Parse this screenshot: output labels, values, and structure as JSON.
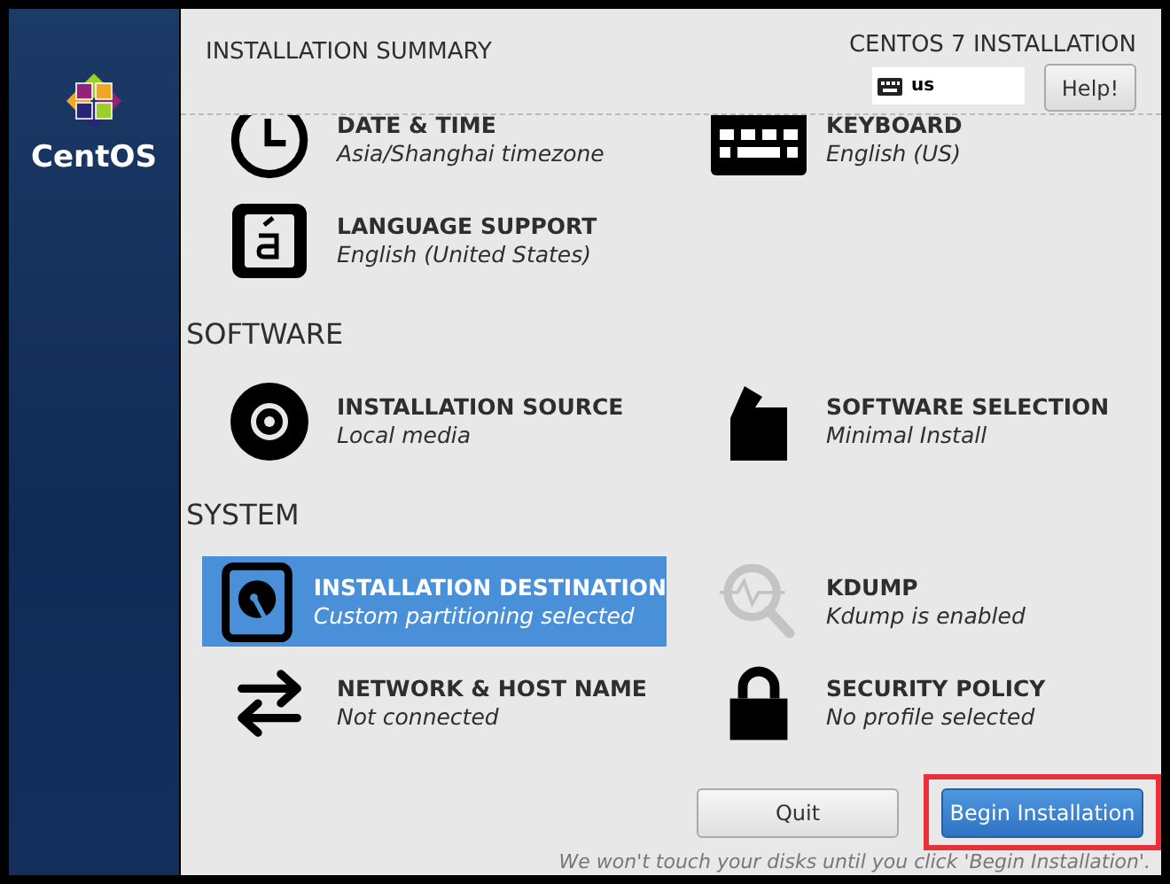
{
  "sidebar": {
    "logo_text": "CentOS"
  },
  "header": {
    "title": "INSTALLATION SUMMARY",
    "product": "CENTOS 7 INSTALLATION",
    "keyboard_layout": "us",
    "help_button": "Help!"
  },
  "sections": [
    {
      "items": [
        {
          "title": "DATE & TIME",
          "status": "Asia/Shanghai timezone",
          "selected": false
        },
        {
          "title": "KEYBOARD",
          "status": "English (US)",
          "selected": false
        },
        {
          "title": "LANGUAGE SUPPORT",
          "status": "English (United States)",
          "selected": false
        }
      ]
    },
    {
      "heading": "SOFTWARE",
      "items": [
        {
          "title": "INSTALLATION SOURCE",
          "status": "Local media",
          "selected": false
        },
        {
          "title": "SOFTWARE SELECTION",
          "status": "Minimal Install",
          "selected": false
        }
      ]
    },
    {
      "heading": "SYSTEM",
      "items": [
        {
          "title": "INSTALLATION DESTINATION",
          "status": "Custom partitioning selected",
          "selected": true
        },
        {
          "title": "KDUMP",
          "status": "Kdump is enabled",
          "selected": false
        },
        {
          "title": "NETWORK & HOST NAME",
          "status": "Not connected",
          "selected": false
        },
        {
          "title": "SECURITY POLICY",
          "status": "No profile selected",
          "selected": false
        }
      ]
    }
  ],
  "buttons": [
    {
      "label": "Quit",
      "kind": "secondary",
      "highlighted": false
    },
    {
      "label": "Begin Installation",
      "kind": "primary",
      "highlighted": true
    }
  ],
  "footer_note": "We won't touch your disks until you click 'Begin Installation'."
}
